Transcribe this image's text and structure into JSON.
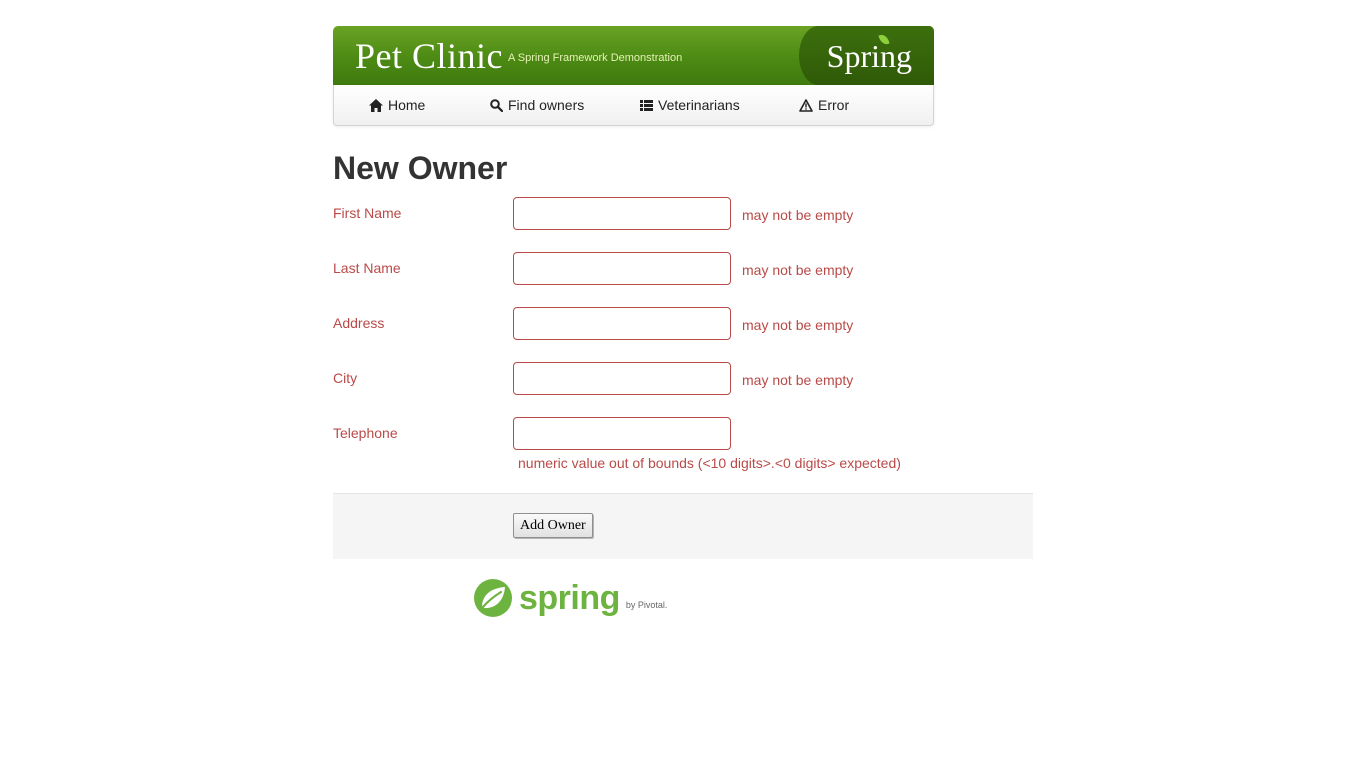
{
  "banner": {
    "title": "Pet Clinic",
    "subtitle": "A Spring Framework Demonstration",
    "brand": "Spring"
  },
  "nav": {
    "items": [
      {
        "label": "Home",
        "icon": "home-icon"
      },
      {
        "label": "Find owners",
        "icon": "search-icon"
      },
      {
        "label": "Veterinarians",
        "icon": "list-icon"
      },
      {
        "label": "Error",
        "icon": "warning-icon"
      }
    ]
  },
  "page": {
    "heading": "New Owner"
  },
  "form": {
    "fields": [
      {
        "label": "First Name",
        "value": "",
        "error": "may not be empty"
      },
      {
        "label": "Last Name",
        "value": "",
        "error": "may not be empty"
      },
      {
        "label": "Address",
        "value": "",
        "error": "may not be empty"
      },
      {
        "label": "City",
        "value": "",
        "error": "may not be empty"
      },
      {
        "label": "Telephone",
        "value": "",
        "error": "numeric value out of bounds (<10 digits>.<0 digits> expected)"
      }
    ],
    "submit_label": "Add Owner"
  },
  "footer": {
    "logo_word": "spring",
    "logo_by": "by Pivotal."
  },
  "colors": {
    "brand_green": "#6db33f",
    "error_red": "#b94a48",
    "banner_green": "#4c8a14"
  }
}
